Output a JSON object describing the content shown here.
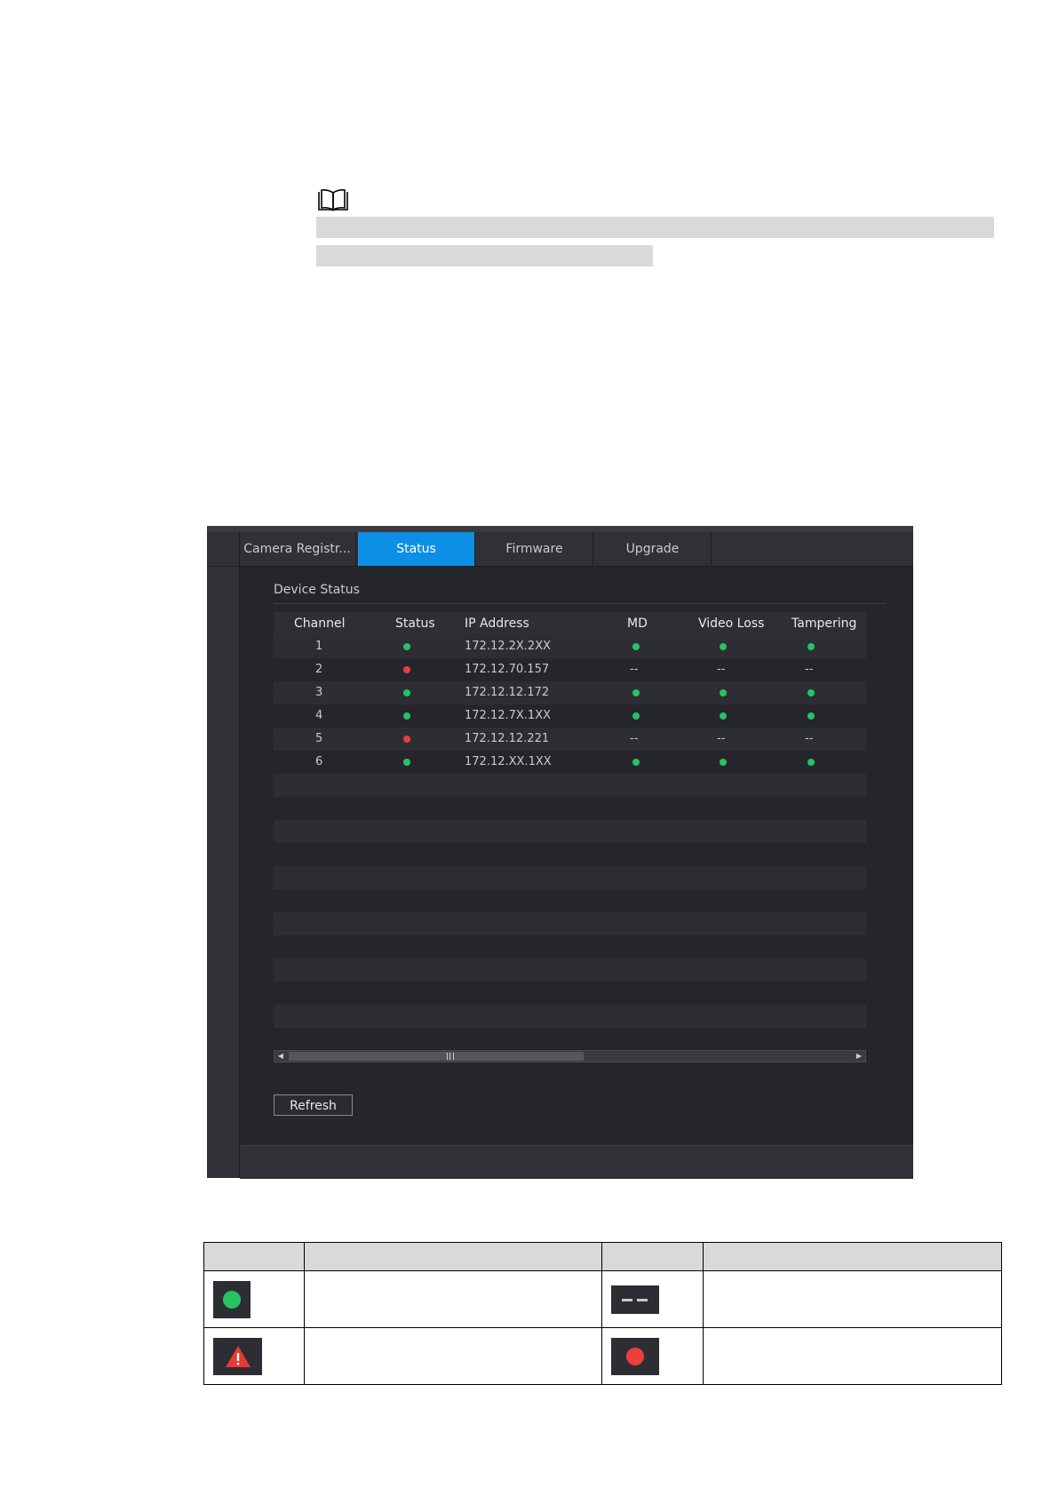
{
  "tabs": [
    {
      "label": "Camera Registr...",
      "active": false
    },
    {
      "label": "Status",
      "active": true
    },
    {
      "label": "Firmware",
      "active": false
    },
    {
      "label": "Upgrade",
      "active": false
    }
  ],
  "device_status": {
    "title": "Device Status",
    "columns": [
      "Channel",
      "Status",
      "IP Address",
      "MD",
      "Video Loss",
      "Tampering"
    ],
    "rows": [
      {
        "channel": "1",
        "status": "green",
        "ip": "172.12.2X.2XX",
        "md": "green",
        "video_loss": "green",
        "tampering": "green"
      },
      {
        "channel": "2",
        "status": "red",
        "ip": "172.12.70.157",
        "md": "--",
        "video_loss": "--",
        "tampering": "--"
      },
      {
        "channel": "3",
        "status": "green",
        "ip": "172.12.12.172",
        "md": "green",
        "video_loss": "green",
        "tampering": "green"
      },
      {
        "channel": "4",
        "status": "green",
        "ip": "172.12.7X.1XX",
        "md": "green",
        "video_loss": "green",
        "tampering": "green"
      },
      {
        "channel": "5",
        "status": "red",
        "ip": "172.12.12.221",
        "md": "--",
        "video_loss": "--",
        "tampering": "--"
      },
      {
        "channel": "6",
        "status": "green",
        "ip": "172.12.XX.1XX",
        "md": "green",
        "video_loss": "green",
        "tampering": "green"
      }
    ],
    "empty_rows": 12
  },
  "refresh_label": "Refresh",
  "colors": {
    "active_tab": "#0d8fe6",
    "status_ok": "#27c35e",
    "status_error": "#ee3d3d",
    "warning": "#e53935"
  },
  "icons": {
    "note": "book-icon",
    "legend": [
      "green-dot-icon",
      "dash-icon",
      "warning-triangle-icon",
      "red-dot-icon"
    ]
  }
}
